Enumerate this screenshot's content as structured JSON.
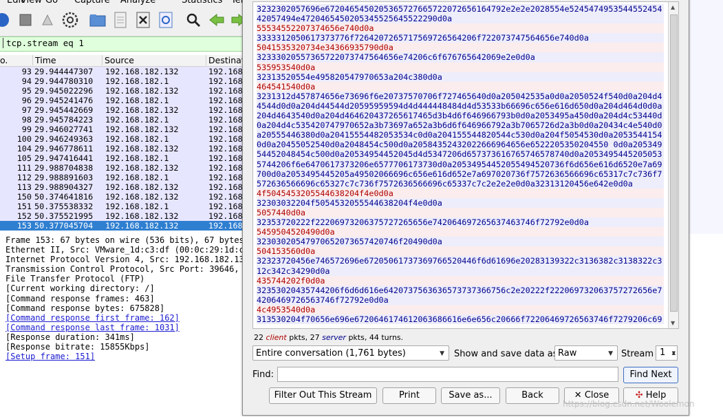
{
  "menubar": [
    "Edit",
    "View",
    "Go",
    "Capture",
    "Analyze",
    "Statistics",
    "Tel"
  ],
  "toolbar": {
    "icons": [
      "stop-capture-icon",
      "restart-capture-icon",
      "capture-options-icon",
      "open-file-icon",
      "file-icon",
      "close-file-icon",
      "reload-icon",
      "find-icon",
      "back-icon",
      "forward-icon"
    ]
  },
  "filter": {
    "value": "tcp.stream eq 1"
  },
  "packet_list": {
    "columns": [
      "o.",
      "Time",
      "Source",
      "Destinat"
    ],
    "rows": [
      {
        "no": "93",
        "time": "29.944447307",
        "src": "192.168.182.132",
        "dst": "192.168"
      },
      {
        "no": "94",
        "time": "29.944780310",
        "src": "192.168.182.1",
        "dst": "192.168"
      },
      {
        "no": "95",
        "time": "29.945022296",
        "src": "192.168.182.132",
        "dst": "192.168"
      },
      {
        "no": "96",
        "time": "29.945241476",
        "src": "192.168.182.1",
        "dst": "192.168"
      },
      {
        "no": "97",
        "time": "29.945442669",
        "src": "192.168.182.132",
        "dst": "192.168"
      },
      {
        "no": "98",
        "time": "29.945784223",
        "src": "192.168.182.1",
        "dst": "192.168"
      },
      {
        "no": "99",
        "time": "29.946027741",
        "src": "192.168.182.132",
        "dst": "192.168"
      },
      {
        "no": "100",
        "time": "29.946249363",
        "src": "192.168.182.1",
        "dst": "192.168"
      },
      {
        "no": "104",
        "time": "29.946778611",
        "src": "192.168.182.132",
        "dst": "192.168"
      },
      {
        "no": "105",
        "time": "29.947416441",
        "src": "192.168.182.1",
        "dst": "192.168"
      },
      {
        "no": "111",
        "time": "29.988704838",
        "src": "192.168.182.132",
        "dst": "192.168"
      },
      {
        "no": "112",
        "time": "29.988891603",
        "src": "192.168.182.1",
        "dst": "192.168"
      },
      {
        "no": "113",
        "time": "29.988904327",
        "src": "192.168.182.132",
        "dst": "192.168"
      },
      {
        "no": "150",
        "time": "50.374641816",
        "src": "192.168.182.132",
        "dst": "192.168"
      },
      {
        "no": "151",
        "time": "50.375538332",
        "src": "192.168.182.1",
        "dst": "192.168"
      },
      {
        "no": "152",
        "time": "50.375521995",
        "src": "192.168.182.132",
        "dst": "192.168"
      },
      {
        "no": "153",
        "time": "50.377045704",
        "src": "192.168.182.132",
        "dst": "192.168"
      }
    ]
  },
  "details": {
    "lines": [
      "Frame 153: 67 bytes on wire (536 bits), 67 bytes",
      "Ethernet II, Src: VMware_1d:c3:df (00:0c:29:1d:c",
      "Internet Protocol Version 4, Src: 192.168.182.13",
      "Transmission Control Protocol, Src Port: 39646,",
      "File Transfer Protocol (FTP)",
      "[Current working directory: /]",
      "[Command response frames: 463]",
      "[Command response bytes: 675828]",
      "[Command response first frame: 162]",
      "[Command response last frame: 1031]",
      "[Response duration: 341ms]",
      "[Response bitrate: 15855Kbps]",
      "[Setup frame: 151]"
    ]
  },
  "stream": {
    "blocks": [
      {
        "dir": "server",
        "text": "3232302057696e6720465450205365727665722072656164792e2e2e2028554e524547495354455245442057494e4720465450205345525645522290d0a"
      },
      {
        "dir": "client",
        "text": "55534552207374656e740d0a"
      },
      {
        "dir": "server",
        "text": "3333312050617373776f7264207265717569726564206f722073747564656e740d0a"
      },
      {
        "dir": "client",
        "text": "5041535320734e34366935790d0a"
      },
      {
        "dir": "server",
        "text": "32333020557365722073747564656e74206c6f676765642069e2e0d0a"
      },
      {
        "dir": "client",
        "text": "535953540d0a"
      },
      {
        "dir": "server",
        "text": "32313520554e495820547970653a204c380d0a"
      },
      {
        "dir": "client",
        "text": "464541540d0a"
      },
      {
        "dir": "server",
        "text": "3231312d457874656e73696f6e20737570706f727465640d0a205042535a0d0a2050524f540d0a204d44544d0d0a204d44544d20595959594d4d444448484d4d53533b66696c656e616d650d0a204d464d0d0a204d4643540d0a204d464620437265617465d3b4d6f646966793b0d0a2053495a450d0a204d4c53440d0a204d4c535420747970652a3b73697a652a3b6d6f646966792a3b7065726d2a3b0d0a20434c4e540d0a20555446380d0a20415554482053534c0d0a204155544820544c530d0a204f5054530d0a20535441540d0a20455052540d0a2048454c500d0a20584352432022666964656e6522205350204550 0d0a20534954452048454c500d0a20534954452045d4d5347206d657373616765746578740d0a20534954452050535744206f6e6470617373206e6577706173730d0a20534954452055494520736f6d656e616d6520e7a69700d0a2053495445205a49502066696c656e616d652e7a697020736f7572636566696c65317c7c736f7572636566696c65327c7c736f7572636566696c65337c7c2e2e2e0d0a32313120456e642e0d0a"
      },
      {
        "dir": "client",
        "text": "4f5045453205544638204f4e0d0a"
      },
      {
        "dir": "server",
        "text": "32303032204f5054532055544638204f4e0d0a"
      },
      {
        "dir": "client",
        "text": "5057440d0a"
      },
      {
        "dir": "server",
        "text": "32353720222f22206973206375727265656e742064697265637463746f72792e0d0a"
      },
      {
        "dir": "client",
        "text": "5459504520490d0a"
      },
      {
        "dir": "server",
        "text": "32303020547970652073657420746f20490d0a"
      },
      {
        "dir": "client",
        "text": "504153560d0a"
      },
      {
        "dir": "server",
        "text": "32323720456e746572696e67205061737369766520446f6d61696e20283139322c3136382c3138322c312c342c34290d0a"
      },
      {
        "dir": "client",
        "text": "435744202f0d0a"
      },
      {
        "dir": "server",
        "text": "32353020435744206f6d6d616e6420737563636573737366756c2e20222f222069732063757272656e74206469726563746f72792e0d0a"
      },
      {
        "dir": "client",
        "text": "4c4953540d0a"
      },
      {
        "dir": "server",
        "text": "313530204f70656e696e6720646174612063686616e6e656c20666f72206469726563746f7279206c69"
      }
    ]
  },
  "stats": {
    "client_count": "22",
    "client_label": "client",
    "mid1": "pkts,",
    "server_count": "27",
    "server_label": "server",
    "tail": "pkts, 44 turns."
  },
  "conversation": {
    "selected": "Entire conversation (1,761 bytes)"
  },
  "show_as": {
    "label": "Show and save data as",
    "selected": "Raw"
  },
  "stream_number": {
    "label": "Stream",
    "value": "1"
  },
  "find": {
    "label": "Find:",
    "value": "",
    "button": "Find Next"
  },
  "buttons": {
    "filter_out": "Filter Out This Stream",
    "print": "Print",
    "save_as": "Save as...",
    "back": "Back",
    "close": "Close",
    "help": "Help"
  },
  "watermark": "https://blog.csdn.net/Woolemon",
  "colors": {
    "client_text": "#b00000",
    "server_text": "#00008e",
    "selection": "#2f7fd1",
    "filter_bg": "#e0ffdc"
  }
}
